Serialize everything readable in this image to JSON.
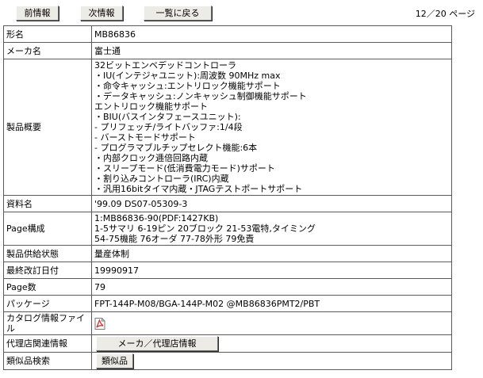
{
  "topbar": {
    "prev_label": "前情報",
    "next_label": "次情報",
    "list_label": "一覧に戻る",
    "page_counter": "12／20 ページ"
  },
  "table": {
    "rows": [
      {
        "label": "形名",
        "value": "MB86836"
      },
      {
        "label": "メーカ名",
        "value": "富士通"
      },
      {
        "label": "製品概要",
        "lines": [
          "32ビットエンベデッドコントローラ",
          "・IU(インテジャユニット):周波数 90MHz max",
          "・命令キャッシュ:エントリロック機能サポート",
          "・データキャッシュ:ノンキャッシュ制御機能サポート",
          " エントリロック機能サポート",
          "・BIU(バスインタフェースユニット):",
          "- プリフェッチ/ライトバッファ:1/4段",
          "- バーストモードサポート",
          "- プログラマブルチップセレクト機能:6本",
          "・内部クロック逓倍回路内蔵",
          "・スリープモード(低消費電力モード)サポート",
          "・割り込みコントローラ(IRC)内蔵",
          "・汎用16bitタイマ内蔵・JTAGテストポートサポート"
        ]
      },
      {
        "label": "資料名",
        "value": "'99.09 DS07-05309-3"
      },
      {
        "label": "Page構成",
        "lines": [
          "1:MB86836-90(PDF:1427KB)",
          "1-5サマリ 6-19ピン 20ブロック 21-53電特,タイミング",
          "54-75機能 76オーダ 77-78外形 79免責"
        ]
      },
      {
        "label": "製品供給状態",
        "value": "量産体制"
      },
      {
        "label": "最終改訂日付",
        "value": "19990917"
      },
      {
        "label": "Page数",
        "value": "79"
      },
      {
        "label": "パッケージ",
        "value": "FPT-144P-M08/BGA-144P-M02 @MB86836PMT2/PBT"
      },
      {
        "label": "カタログ情報ファイル",
        "icon": "pdf-file-icon"
      },
      {
        "label": "代理店関連情報",
        "button": "メーカ／代理店情報"
      },
      {
        "label": "類似品検索",
        "button": "類似品"
      }
    ]
  },
  "colors": {
    "button_face": "#ecebe6",
    "border": "#5a5a5a",
    "pdf_red": "#d0342c"
  }
}
